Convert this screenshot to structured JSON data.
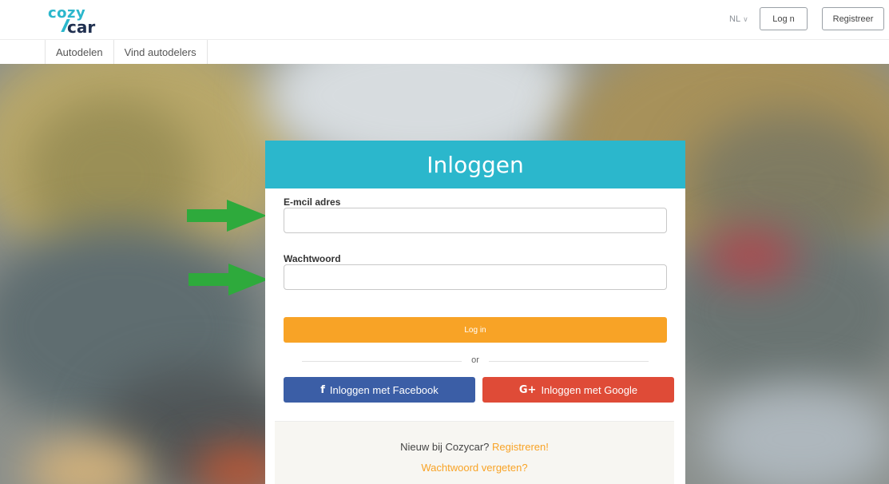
{
  "header": {
    "logo_top": "cozy",
    "logo_bottom": "car",
    "language": "NL",
    "login_label": "Log n",
    "register_label": "Registreer"
  },
  "subnav": {
    "items": [
      {
        "label": "Autodelen"
      },
      {
        "label": "Vind autodelers"
      }
    ]
  },
  "modal": {
    "title": "Inloggen",
    "email_label": "E-mcil adres",
    "email_value": "",
    "password_label": "Wachtwoord",
    "password_value": "",
    "login_button": "Log in",
    "divider_text": "or",
    "facebook_icon": "f",
    "facebook_button": "Inloggen met Facebook",
    "google_icon": "G+",
    "google_button": "Inloggen met Google",
    "new_user_text": "Nieuw bij Cozycar?",
    "register_link": "Registreren!",
    "forgot_link": "Wachtwoord vergeten?"
  },
  "colors": {
    "brand_teal": "#2bb7cc",
    "login_orange": "#f8a326",
    "facebook_blue": "#3b5ea6",
    "google_red": "#df4b37",
    "annotation_arrow_green": "#2eaa3c"
  },
  "icons": {
    "language_dropdown": "chevron-down-icon",
    "annotation": "arrow-right-icon"
  }
}
